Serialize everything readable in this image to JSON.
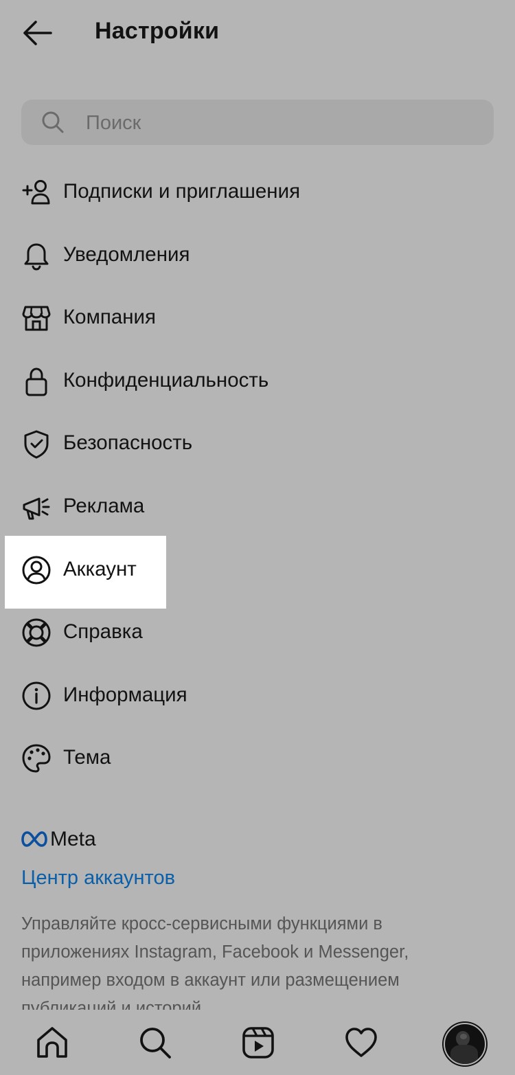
{
  "header": {
    "title": "Настройки",
    "back_icon": "arrow-left-icon"
  },
  "search": {
    "placeholder": "Поиск",
    "value": ""
  },
  "menu": [
    {
      "label": "Подписки и приглашения",
      "icon": "add-person-icon"
    },
    {
      "label": "Уведомления",
      "icon": "bell-icon"
    },
    {
      "label": "Компания",
      "icon": "shop-icon"
    },
    {
      "label": "Конфиденциальность",
      "icon": "lock-icon"
    },
    {
      "label": "Безопасность",
      "icon": "shield-icon"
    },
    {
      "label": "Реклама",
      "icon": "megaphone-icon"
    },
    {
      "label": "Аккаунт",
      "icon": "user-circle-icon",
      "highlighted": true
    },
    {
      "label": "Справка",
      "icon": "lifebuoy-icon"
    },
    {
      "label": "Информация",
      "icon": "info-icon"
    },
    {
      "label": "Тема",
      "icon": "palette-icon"
    }
  ],
  "meta": {
    "logo_text": "Meta",
    "accounts_center": "Центр аккаунтов",
    "description": "Управляйте кросс-сервисными функциями в приложениях Instagram, Facebook и Messenger, например входом в аккаунт или размещением публикаций и историй."
  },
  "tabbar": [
    "home-icon",
    "search-icon",
    "reels-icon",
    "heart-icon",
    "profile-avatar"
  ],
  "colors": {
    "background": "#b5b5b5",
    "search_bg": "#a9a9a9",
    "link": "#0b5fa8",
    "highlight": "#ffffff",
    "text": "#121212",
    "muted": "#555555"
  }
}
